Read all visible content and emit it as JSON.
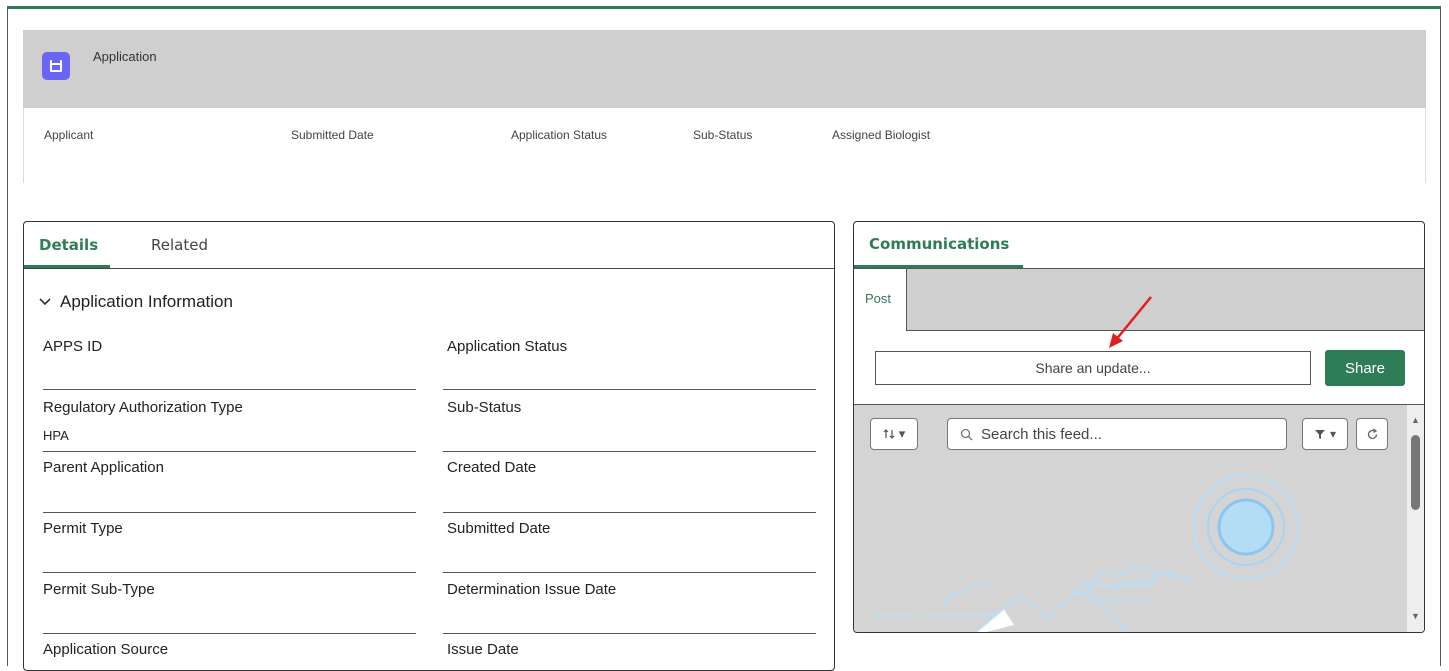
{
  "record": {
    "object_name": "Application",
    "icon": "application-icon",
    "icon_color": "#6966f5",
    "fields": [
      "Applicant",
      "Submitted Date",
      "Application Status",
      "Sub-Status",
      "Assigned Biologist"
    ]
  },
  "details": {
    "tabs": [
      "Details",
      "Related"
    ],
    "active_tab": "Details",
    "section_title": "Application Information",
    "fields": [
      {
        "label": "APPS ID",
        "value": ""
      },
      {
        "label": "Application Status",
        "value": ""
      },
      {
        "label": "Regulatory Authorization Type",
        "value": "HPA"
      },
      {
        "label": "Sub-Status",
        "value": ""
      },
      {
        "label": "Parent Application",
        "value": ""
      },
      {
        "label": "Created Date",
        "value": ""
      },
      {
        "label": "Permit Type",
        "value": ""
      },
      {
        "label": "Submitted Date",
        "value": ""
      },
      {
        "label": "Permit Sub-Type",
        "value": ""
      },
      {
        "label": "Determination Issue Date",
        "value": ""
      },
      {
        "label": "Application Source",
        "value": ""
      },
      {
        "label": "Issue Date",
        "value": ""
      }
    ]
  },
  "communications": {
    "tab": "Communications",
    "post_tab": "Post",
    "share_placeholder": "Share an update...",
    "share_button": "Share",
    "search_placeholder": "Search this feed..."
  },
  "colors": {
    "accent": "#2e7d57",
    "header_bg": "#cfcfcf",
    "annotation_arrow": "#e02020"
  }
}
